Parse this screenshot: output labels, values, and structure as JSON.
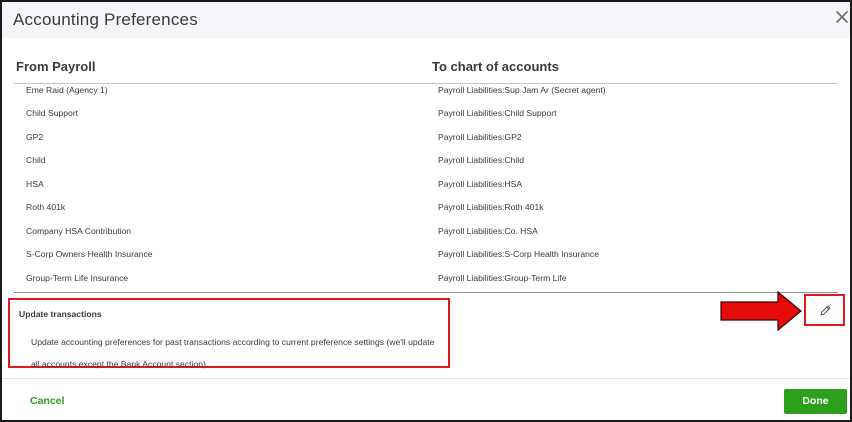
{
  "dialog": {
    "title": "Accounting Preferences"
  },
  "columns": {
    "from_label": "From Payroll",
    "to_label": "To chart of accounts"
  },
  "mappings": [
    {
      "from": "Eme Raid (Agency 1)",
      "to": "Payroll Liabilities:Sup Jam Ar (Secret agent)"
    },
    {
      "from": "Child Support",
      "to": "Payroll Liabilities:Child Support"
    },
    {
      "from": "GP2",
      "to": "Payroll Liabilities:GP2"
    },
    {
      "from": "Child",
      "to": "Payroll Liabilities:Child"
    },
    {
      "from": "HSA",
      "to": "Payroll Liabilities:HSA"
    },
    {
      "from": "Roth 401k",
      "to": "Payroll Liabilities:Roth 401k"
    },
    {
      "from": "Company HSA Contribution",
      "to": "Payroll Liabilities:Co. HSA"
    },
    {
      "from": "S-Corp Owners Health Insurance",
      "to": "Payroll Liabilities:S-Corp Health Insurance"
    },
    {
      "from": "Group-Term Life Insurance",
      "to": "Payroll Liabilities:Group-Term Life"
    }
  ],
  "update": {
    "title": "Update transactions",
    "description": "Update accounting preferences for past transactions according to current preference settings (we'll update all accounts except the Bank Account section)."
  },
  "footer": {
    "cancel_label": "Cancel",
    "done_label": "Done"
  },
  "icons": {
    "close": "close-icon",
    "edit": "pencil-icon",
    "annotation": "arrow-right-icon"
  },
  "colors": {
    "accent_green": "#2ca01c",
    "highlight_red": "#e0191f",
    "header_bg": "#f4f5f8"
  }
}
